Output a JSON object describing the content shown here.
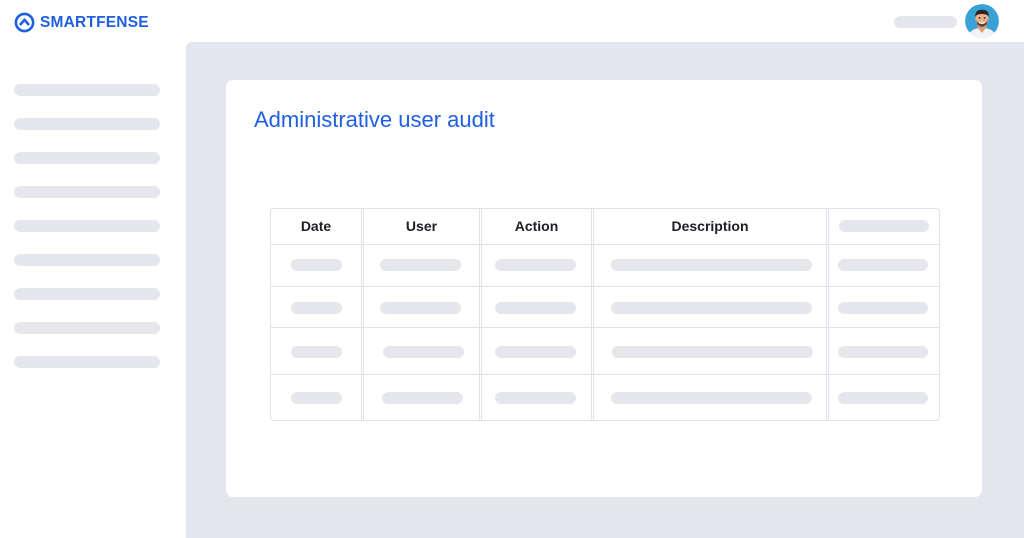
{
  "brand": {
    "name": "SMARTFENSE",
    "color": "#1f5fe0"
  },
  "header": {
    "user_avatar": "user-avatar"
  },
  "sidebar": {
    "item_count": 9
  },
  "page": {
    "title": "Administrative user audit"
  },
  "table": {
    "columns": [
      "Date",
      "User",
      "Action",
      "Description",
      ""
    ],
    "row_count": 4
  },
  "colors": {
    "placeholder": "#e5e7ec",
    "main_background": "#e4e6ed",
    "table_border": "#dfe2e8"
  }
}
